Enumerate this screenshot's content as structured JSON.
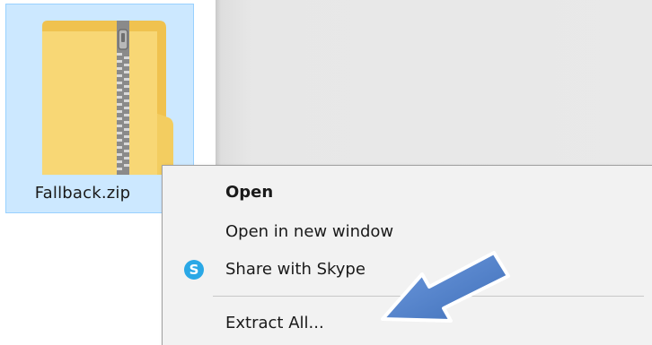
{
  "file": {
    "name": "Fallback.zip",
    "icon": "zip-folder-icon"
  },
  "context_menu": {
    "items": [
      {
        "label": "Open",
        "bold": true
      },
      {
        "label": "Open in new window",
        "bold": false
      },
      {
        "label": "Share with Skype",
        "bold": false,
        "icon": "skype-icon",
        "icon_glyph": "S"
      },
      {
        "label": "Extract All...",
        "bold": false
      }
    ]
  },
  "colors": {
    "selection_bg": "#cce8ff",
    "selection_border": "#99d1ff",
    "menu_bg": "#f2f2f2",
    "folder_yellow": "#f8d775",
    "skype_blue": "#2aa8e6",
    "arrow_blue": "#4a7fc8"
  },
  "annotation": {
    "arrow_points_to": "Extract All..."
  }
}
